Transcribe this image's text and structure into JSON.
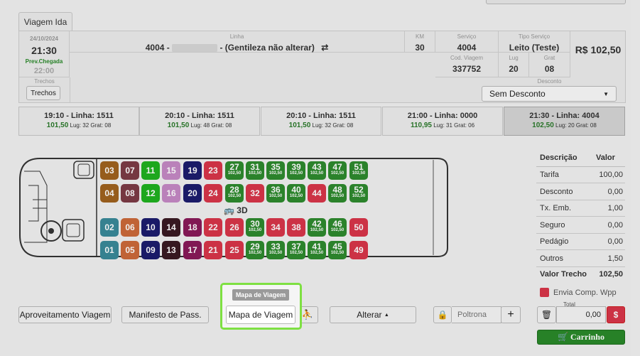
{
  "tab": "Viagem Ida",
  "trip_info": {
    "date": "24/10/2024",
    "time": "21:30",
    "prev_label": "Prev.Chegada",
    "arrival": "22:00",
    "linha_label": "Linha",
    "linha_code": "4004 -",
    "linha_name": "- (Gentileza não alterar)",
    "km_label": "KM",
    "km": "30",
    "servico_label": "Serviço",
    "servico": "4004",
    "tipo_label": "Tipo Serviço",
    "tipo": "Leito (Teste)",
    "price": "R$ 102,50",
    "cod_label": "Cod. Viagem",
    "cod": "337752",
    "lug_label": "Lug",
    "lug": "20",
    "grat_label": "Grat",
    "grat": "08",
    "trechos_label": "Trechos",
    "trechos_button": "Trechos",
    "desconto_label": "Desconto",
    "desconto_value": "Sem Desconto"
  },
  "trips": [
    {
      "time_line": "19:10 - Linha: 1511",
      "price": "101,50",
      "meta": "Lug: 32 Grat: 08"
    },
    {
      "time_line": "20:10 - Linha: 1511",
      "price": "101,50",
      "meta": "Lug: 48 Grat: 08"
    },
    {
      "time_line": "20:10 - Linha: 1511",
      "price": "101,50",
      "meta": "Lug: 32 Grat: 08"
    },
    {
      "time_line": "21:00 - Linha: 0000",
      "price": "110,95",
      "meta": "Lug: 31 Grat: 06"
    },
    {
      "time_line": "21:30 - Linha: 4004",
      "price": "102,50",
      "meta": "Lug: 20 Grat: 08"
    }
  ],
  "bus_label": "3D",
  "seat_price": "102,50",
  "seats": [
    {
      "n": "03",
      "c": "#a0621e"
    },
    {
      "n": "07",
      "c": "#7d3b46"
    },
    {
      "n": "11",
      "c": "#1fb21f"
    },
    {
      "n": "15",
      "c": "#c68ac6"
    },
    {
      "n": "19",
      "c": "#1c1c6e"
    },
    {
      "n": "23",
      "c": "#d9364a"
    },
    {
      "n": "27",
      "c": "#2e8b2e"
    },
    {
      "n": "31",
      "c": "#2e8b2e"
    },
    {
      "n": "35",
      "c": "#2e8b2e"
    },
    {
      "n": "39",
      "c": "#2e8b2e"
    },
    {
      "n": "43",
      "c": "#2e8b2e"
    },
    {
      "n": "47",
      "c": "#2e8b2e"
    },
    {
      "n": "51",
      "c": "#2e8b2e"
    },
    {
      "n": "04",
      "c": "#a0621e"
    },
    {
      "n": "08",
      "c": "#7d3b46"
    },
    {
      "n": "12",
      "c": "#1fb21f"
    },
    {
      "n": "16",
      "c": "#c68ac6"
    },
    {
      "n": "20",
      "c": "#1c1c6e"
    },
    {
      "n": "24",
      "c": "#d9364a"
    },
    {
      "n": "28",
      "c": "#2e8b2e"
    },
    {
      "n": "32",
      "c": "#d9364a"
    },
    {
      "n": "36",
      "c": "#2e8b2e"
    },
    {
      "n": "40",
      "c": "#2e8b2e"
    },
    {
      "n": "44",
      "c": "#d9364a"
    },
    {
      "n": "48",
      "c": "#2e8b2e"
    },
    {
      "n": "52",
      "c": "#2e8b2e"
    },
    {
      "n": "02",
      "c": "#3a8a9a"
    },
    {
      "n": "06",
      "c": "#cc6a3a"
    },
    {
      "n": "10",
      "c": "#1c1c6e"
    },
    {
      "n": "14",
      "c": "#3a1a22"
    },
    {
      "n": "18",
      "c": "#8a1a5a"
    },
    {
      "n": "22",
      "c": "#d9364a"
    },
    {
      "n": "26",
      "c": "#d9364a"
    },
    {
      "n": "30",
      "c": "#2e8b2e"
    },
    {
      "n": "34",
      "c": "#d9364a"
    },
    {
      "n": "38",
      "c": "#d9364a"
    },
    {
      "n": "42",
      "c": "#2e8b2e"
    },
    {
      "n": "46",
      "c": "#2e8b2e"
    },
    {
      "n": "50",
      "c": "#d9364a"
    },
    {
      "n": "01",
      "c": "#3a8a9a"
    },
    {
      "n": "05",
      "c": "#cc6a3a"
    },
    {
      "n": "09",
      "c": "#1c1c6e"
    },
    {
      "n": "13",
      "c": "#3a1a22"
    },
    {
      "n": "17",
      "c": "#8a1a5a"
    },
    {
      "n": "21",
      "c": "#d9364a"
    },
    {
      "n": "25",
      "c": "#d9364a"
    },
    {
      "n": "29",
      "c": "#2e8b2e"
    },
    {
      "n": "33",
      "c": "#2e8b2e"
    },
    {
      "n": "37",
      "c": "#2e8b2e"
    },
    {
      "n": "41",
      "c": "#2e8b2e"
    },
    {
      "n": "45",
      "c": "#2e8b2e"
    },
    {
      "n": "49",
      "c": "#d9364a"
    }
  ],
  "summary": {
    "h_desc": "Descrição",
    "h_val": "Valor",
    "rows": [
      {
        "k": "Tarifa",
        "v": "100,00"
      },
      {
        "k": "Desconto",
        "v": "0,00"
      },
      {
        "k": "Tx. Emb.",
        "v": "1,00"
      },
      {
        "k": "Seguro",
        "v": "0,00"
      },
      {
        "k": "Pedágio",
        "v": "0,00"
      },
      {
        "k": "Outros",
        "v": "1,50"
      }
    ],
    "total_label": "Valor Trecho",
    "total": "102,50",
    "wpp": "Envia Comp. Wpp"
  },
  "actions": {
    "aproveitamento": "Aproveitamento Viagem",
    "manifesto": "Manifesto de Pass.",
    "mapa": "Mapa de Viagem",
    "tooltip": "Mapa de Viagem",
    "alterar": "Alterar",
    "poltrona_placeholder": "Poltrona",
    "total_label": "Total",
    "total_value": "0,00",
    "carrinho": "Carrinho"
  }
}
